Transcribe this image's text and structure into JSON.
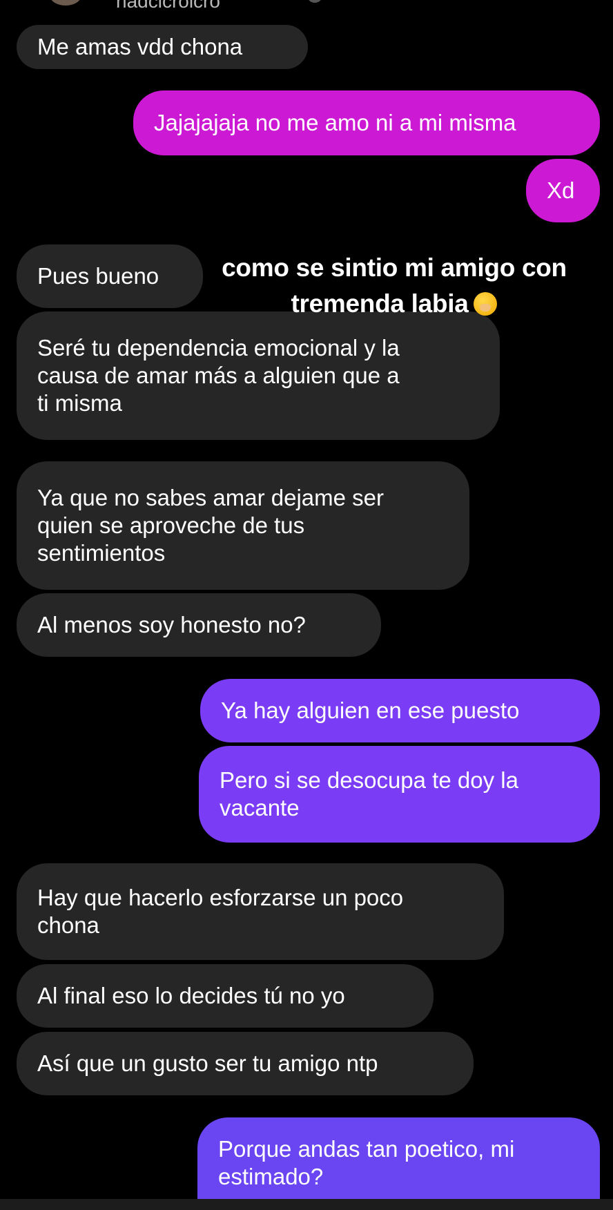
{
  "header": {
    "username": "hadcicrolcro"
  },
  "overlay_caption": {
    "line1": "como se sintio mi amigo con",
    "line2": "tremenda labia"
  },
  "messages": [
    {
      "from": "them",
      "text": "Me amas vdd chona"
    },
    {
      "from": "me",
      "text": "Jajajajaja no me amo ni a mi misma",
      "color": "#cc1ad4"
    },
    {
      "from": "me",
      "text": "Xd",
      "color": "#cc1ad4"
    },
    {
      "from": "them",
      "text": "Pues bueno"
    },
    {
      "from": "them",
      "text": "Seré tu dependencia emocional y la\ncausa de amar más a alguien que a\nti misma"
    },
    {
      "from": "them",
      "text": "Ya que no sabes amar dejame ser\nquien se aproveche de tus\nsentimientos"
    },
    {
      "from": "them",
      "text": "Al menos soy honesto no?"
    },
    {
      "from": "me",
      "text": "Ya hay alguien en ese puesto",
      "color": "#7a3df5"
    },
    {
      "from": "me",
      "text": "Pero si se desocupa te doy la\nvacante",
      "color": "#7a3df5"
    },
    {
      "from": "them",
      "text": "Hay que hacerlo esforzarse un poco\nchona"
    },
    {
      "from": "them",
      "text": "Al final eso lo decides tú no yo"
    },
    {
      "from": "them",
      "text": "Así que un gusto ser tu amigo ntp"
    },
    {
      "from": "me",
      "text": "Porque andas tan poetico, mi\nestimado?",
      "color": "#6a45f2"
    }
  ],
  "colors": {
    "incoming_bubble": "#262626",
    "background": "#000000",
    "text": "#ffffff"
  }
}
